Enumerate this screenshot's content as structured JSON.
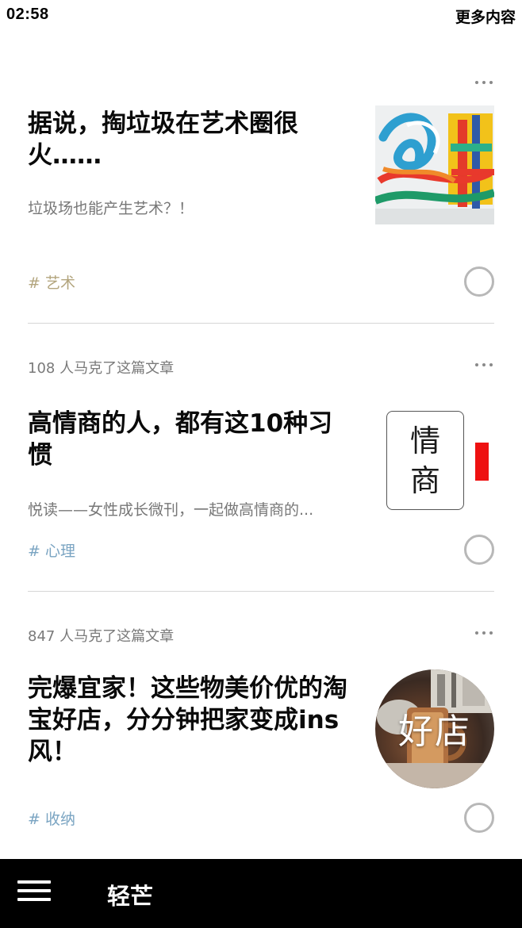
{
  "status_bar": {
    "time": "02:58",
    "more_label": "更多内容"
  },
  "articles": [
    {
      "marked_text": "",
      "title": "据说，掏垃圾在艺术圈很火……",
      "subtitle": "垃圾场也能产生艺术？！",
      "tag": "# 艺术",
      "thumbnail_icon": "abstract-art-sculpture",
      "tag_color": "#b3a57e"
    },
    {
      "marked_text": "108 人马克了这篇文章",
      "title": "高情商的人，都有这10种习惯",
      "subtitle": "悦读——女性成长微刊，一起做高情商的...",
      "tag": "# 心理",
      "thumbnail_text": [
        "情",
        "商"
      ],
      "tag_color": "#7aa4c2"
    },
    {
      "marked_text": "847 人马克了这篇文章",
      "title": "完爆宜家！这些物美价优的淘宝好店，分分钟把家变成ins风！",
      "subtitle": "",
      "tag": "# 收纳",
      "thumbnail_text": "好店",
      "tag_color": "#7aa4c2"
    }
  ],
  "bottom_bar": {
    "app_name": "轻芒",
    "menu_icon": "hamburger-menu-icon"
  },
  "colors": {
    "bottom_bar_bg": "#000000",
    "tag_art": "#b3a57e",
    "tag_blue": "#7aa4c2",
    "accent_red": "#ee1111"
  }
}
